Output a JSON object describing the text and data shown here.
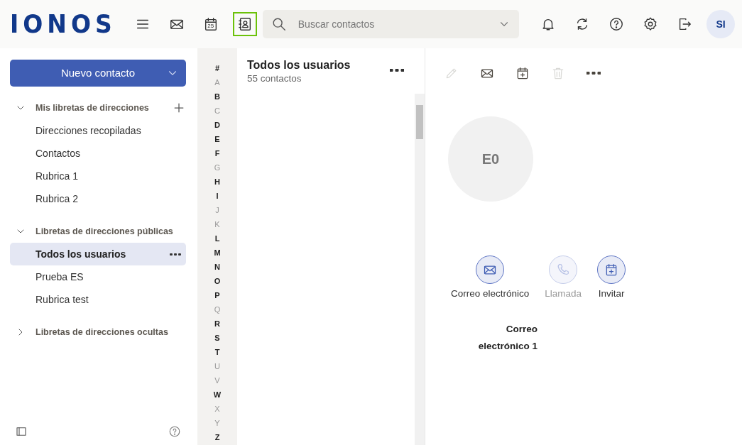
{
  "header": {
    "logo": "IONOS",
    "apps": [
      {
        "kind": "menu",
        "selected": false
      },
      {
        "kind": "mail",
        "selected": false
      },
      {
        "kind": "calendar",
        "label": "25",
        "selected": false
      },
      {
        "kind": "contacts",
        "selected": true
      }
    ],
    "search": {
      "placeholder": "Buscar contactos"
    },
    "tools": [
      {
        "kind": "bell"
      },
      {
        "kind": "refresh"
      },
      {
        "kind": "help"
      },
      {
        "kind": "settings"
      },
      {
        "kind": "logout"
      }
    ],
    "avatar": "SI"
  },
  "sidebar": {
    "new_button": "Nuevo contacto",
    "sections": [
      {
        "title": "Mis libretas de direcciones",
        "expanded": true,
        "can_add": true,
        "items": [
          {
            "label": "Direcciones recopiladas",
            "selected": false
          },
          {
            "label": "Contactos",
            "selected": false
          },
          {
            "label": "Rubrica 1",
            "selected": false
          },
          {
            "label": "Rubrica 2",
            "selected": false
          }
        ]
      },
      {
        "title": "Libretas de direcciones públicas",
        "expanded": true,
        "can_add": false,
        "items": [
          {
            "label": "Todos los usuarios",
            "selected": true
          },
          {
            "label": "Prueba ES",
            "selected": false
          },
          {
            "label": "Rubrica test",
            "selected": false
          }
        ]
      },
      {
        "title": "Libretas de direcciones ocultas",
        "expanded": false,
        "can_add": false
      }
    ]
  },
  "letters": [
    {
      "label": "#",
      "disabled": false
    },
    {
      "label": "A",
      "disabled": true
    },
    {
      "label": "B",
      "disabled": false
    },
    {
      "label": "C",
      "disabled": true
    },
    {
      "label": "D",
      "disabled": false
    },
    {
      "label": "E",
      "disabled": false
    },
    {
      "label": "F",
      "disabled": false
    },
    {
      "label": "G",
      "disabled": true
    },
    {
      "label": "H",
      "disabled": false
    },
    {
      "label": "I",
      "disabled": false
    },
    {
      "label": "J",
      "disabled": true
    },
    {
      "label": "K",
      "disabled": true
    },
    {
      "label": "L",
      "disabled": false
    },
    {
      "label": "M",
      "disabled": false
    },
    {
      "label": "N",
      "disabled": false
    },
    {
      "label": "O",
      "disabled": false
    },
    {
      "label": "P",
      "disabled": false
    },
    {
      "label": "Q",
      "disabled": true
    },
    {
      "label": "R",
      "disabled": false
    },
    {
      "label": "S",
      "disabled": false
    },
    {
      "label": "T",
      "disabled": false
    },
    {
      "label": "U",
      "disabled": true
    },
    {
      "label": "V",
      "disabled": true
    },
    {
      "label": "W",
      "disabled": false
    },
    {
      "label": "X",
      "disabled": true
    },
    {
      "label": "Y",
      "disabled": true
    },
    {
      "label": "Z",
      "disabled": false
    }
  ],
  "list": {
    "title": "Todos los usuarios",
    "count": "55 contactos"
  },
  "detail": {
    "toolbar": [
      {
        "kind": "edit",
        "disabled": true
      },
      {
        "kind": "mail",
        "disabled": false
      },
      {
        "kind": "calendar",
        "disabled": false
      },
      {
        "kind": "delete",
        "disabled": true
      },
      {
        "kind": "more",
        "disabled": false
      }
    ],
    "initials": "E0",
    "actions": [
      {
        "kind": "mail",
        "label": "Correo electrónico",
        "disabled": false
      },
      {
        "kind": "phone",
        "label": "Llamada",
        "disabled": true
      },
      {
        "kind": "calendar",
        "label": "Invitar",
        "disabled": false
      }
    ],
    "field_label": "Correo electrónico 1"
  }
}
